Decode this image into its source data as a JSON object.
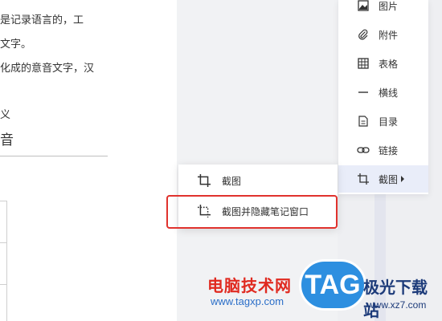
{
  "document": {
    "lines": [
      "是记录语言的，工",
      "文字。",
      "化成的意音文字，汉",
      "义"
    ],
    "heading": "音"
  },
  "insert_menu": {
    "items": [
      {
        "label": "图片",
        "icon": "image-icon"
      },
      {
        "label": "附件",
        "icon": "paperclip-icon"
      },
      {
        "label": "表格",
        "icon": "table-icon"
      },
      {
        "label": "横线",
        "icon": "horizontal-line-icon"
      },
      {
        "label": "目录",
        "icon": "document-list-icon"
      },
      {
        "label": "链接",
        "icon": "link-icon"
      },
      {
        "label": "截图",
        "icon": "crop-icon"
      }
    ]
  },
  "submenu": {
    "items": [
      {
        "label": "截图",
        "icon": "crop-icon"
      },
      {
        "label": "截图并隐藏笔记窗口",
        "icon": "crop-dotted-icon"
      }
    ]
  },
  "watermark": {
    "text": "电脑技术网",
    "url": "www.tagxp.com",
    "logo": "TAG",
    "site": "极光下载站",
    "site_url": "www.xz7.com"
  },
  "colors": {
    "accent_highlight": "#e0322d",
    "active_item_bg": "#e9edf9"
  }
}
